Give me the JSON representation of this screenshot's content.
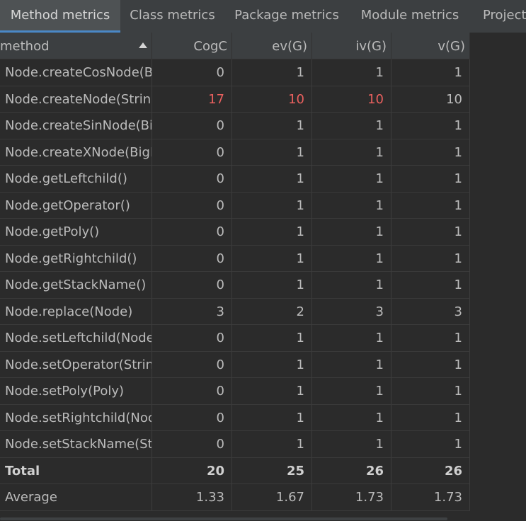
{
  "tabs": [
    {
      "label": "Method metrics",
      "active": true
    },
    {
      "label": "Class metrics",
      "active": false
    },
    {
      "label": "Package metrics",
      "active": false
    },
    {
      "label": "Module metrics",
      "active": false
    },
    {
      "label": "Project",
      "active": false
    }
  ],
  "table": {
    "columns": [
      "method",
      "CogC",
      "ev(G)",
      "iv(G)",
      "v(G)"
    ],
    "sort": {
      "column": "method",
      "direction": "ascending"
    },
    "rows": [
      {
        "name": "Node.createCosNode(Bi",
        "values": [
          "0",
          "1",
          "1",
          "1"
        ],
        "highlight": false
      },
      {
        "name": "Node.createNode(String",
        "values": [
          "17",
          "10",
          "10",
          "10"
        ],
        "highlight": true
      },
      {
        "name": "Node.createSinNode(Big",
        "values": [
          "0",
          "1",
          "1",
          "1"
        ],
        "highlight": false
      },
      {
        "name": "Node.createXNode(BigIn",
        "values": [
          "0",
          "1",
          "1",
          "1"
        ],
        "highlight": false
      },
      {
        "name": "Node.getLeftchild()",
        "values": [
          "0",
          "1",
          "1",
          "1"
        ],
        "highlight": false
      },
      {
        "name": "Node.getOperator()",
        "values": [
          "0",
          "1",
          "1",
          "1"
        ],
        "highlight": false
      },
      {
        "name": "Node.getPoly()",
        "values": [
          "0",
          "1",
          "1",
          "1"
        ],
        "highlight": false
      },
      {
        "name": "Node.getRightchild()",
        "values": [
          "0",
          "1",
          "1",
          "1"
        ],
        "highlight": false
      },
      {
        "name": "Node.getStackName()",
        "values": [
          "0",
          "1",
          "1",
          "1"
        ],
        "highlight": false
      },
      {
        "name": "Node.replace(Node)",
        "values": [
          "3",
          "2",
          "3",
          "3"
        ],
        "highlight": false
      },
      {
        "name": "Node.setLeftchild(Node)",
        "values": [
          "0",
          "1",
          "1",
          "1"
        ],
        "highlight": false
      },
      {
        "name": "Node.setOperator(String",
        "values": [
          "0",
          "1",
          "1",
          "1"
        ],
        "highlight": false
      },
      {
        "name": "Node.setPoly(Poly)",
        "values": [
          "0",
          "1",
          "1",
          "1"
        ],
        "highlight": false
      },
      {
        "name": "Node.setRightchild(Noc",
        "values": [
          "0",
          "1",
          "1",
          "1"
        ],
        "highlight": false
      },
      {
        "name": "Node.setStackName(Str",
        "values": [
          "0",
          "1",
          "1",
          "1"
        ],
        "highlight": false
      }
    ],
    "total": {
      "name": "Total",
      "values": [
        "20",
        "25",
        "26",
        "26"
      ]
    },
    "average": {
      "name": "Average",
      "values": [
        "1.33",
        "1.67",
        "1.73",
        "1.73"
      ]
    }
  },
  "colors": {
    "highlight": "#e8605e",
    "active_tab_underline": "#4a88c7"
  }
}
